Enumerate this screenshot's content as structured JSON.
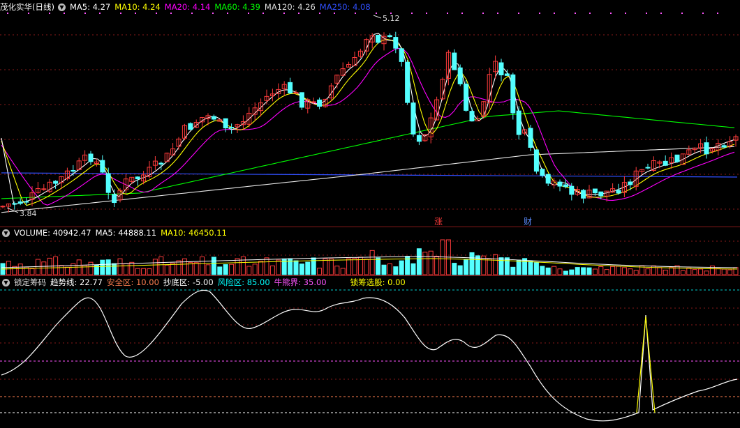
{
  "price_panel": {
    "title": "茂化实华(日线)",
    "ma_items": [
      {
        "label": "MA5: 4.27",
        "color": "#ffffff"
      },
      {
        "label": "MA10: 4.24",
        "color": "#ffff00"
      },
      {
        "label": "MA20: 4.14",
        "color": "#ff00ff"
      },
      {
        "label": "MA60: 4.39",
        "color": "#00ff00"
      },
      {
        "label": "MA120: 4.26",
        "color": "#dddddd"
      },
      {
        "label": "MA250: 4.08",
        "color": "#3050ff"
      }
    ],
    "high_label": "5.12",
    "low_label": "3.84",
    "marker_up": "涨",
    "marker_finance": "财"
  },
  "volume_panel": {
    "items": [
      {
        "label": "VOLUME: 40942.47",
        "color": "#ffffff"
      },
      {
        "label": "MA5: 44888.11",
        "color": "#ffffff"
      },
      {
        "label": "MA10: 46450.11",
        "color": "#ffff00"
      }
    ]
  },
  "indicator_panel": {
    "items": [
      {
        "label": "锁定筹码",
        "color": "#dddddd"
      },
      {
        "label": "趋势线: 22.77",
        "color": "#ffffff"
      },
      {
        "label": "安全区: 10.00",
        "color": "#ff7f50"
      },
      {
        "label": "抄底区: -5.00",
        "color": "#ffffff"
      },
      {
        "label": "风险区: 85.00",
        "color": "#00ffff"
      },
      {
        "label": "牛熊界: 35.00",
        "color": "#ff55ff"
      },
      {
        "label": "锁筹选股: 0.00",
        "color": "#ffff00"
      }
    ]
  },
  "colors": {
    "up": "#ff3b3b",
    "down": "#54ffff",
    "grid": "#8a1a1a"
  }
}
